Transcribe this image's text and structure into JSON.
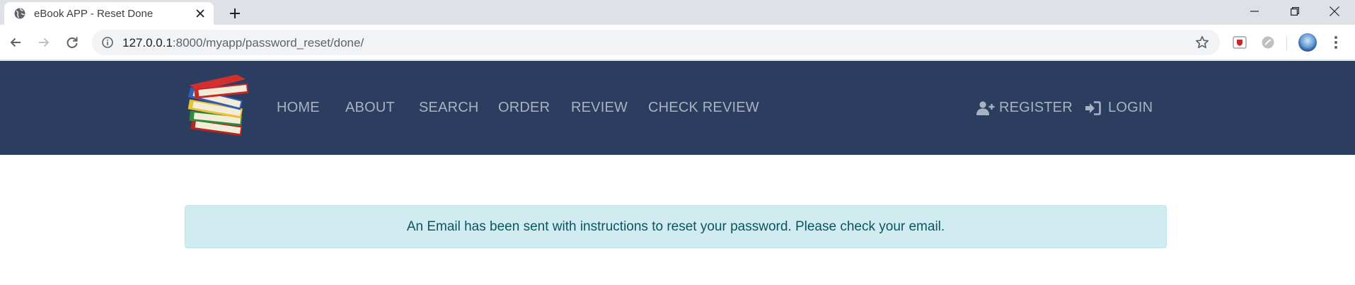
{
  "browser": {
    "tab": {
      "title": "eBook APP - Reset Done"
    },
    "address": {
      "host": "127.0.0.1",
      "rest": ":8000/myapp/password_reset/done/"
    }
  },
  "navbar": {
    "items": [
      {
        "label": "HOME"
      },
      {
        "label": "ABOUT"
      },
      {
        "label": "SEARCH"
      },
      {
        "label": "ORDER"
      },
      {
        "label": "REVIEW"
      },
      {
        "label": "CHECK REVIEW"
      }
    ],
    "register_label": "REGISTER",
    "login_label": "LOGIN"
  },
  "alert": {
    "message": "An Email has been sent with instructions to reset your password. Please check your email."
  },
  "icons": {
    "favicon": "globe-icon",
    "tab_close": "close-icon",
    "new_tab": "plus-icon",
    "back": "arrow-left-icon",
    "forward": "arrow-right-icon",
    "reload": "reload-icon",
    "site_info": "info-icon",
    "bookmark": "star-icon",
    "register": "user-plus-icon",
    "login": "sign-in-icon",
    "logo": "books-stack-icon"
  },
  "colors": {
    "navbar_bg": "#2b3e5f",
    "nav_link": "#a8b2c2",
    "alert_bg": "#d1ecf1",
    "alert_border": "#bee5eb",
    "alert_text": "#0c5460"
  }
}
